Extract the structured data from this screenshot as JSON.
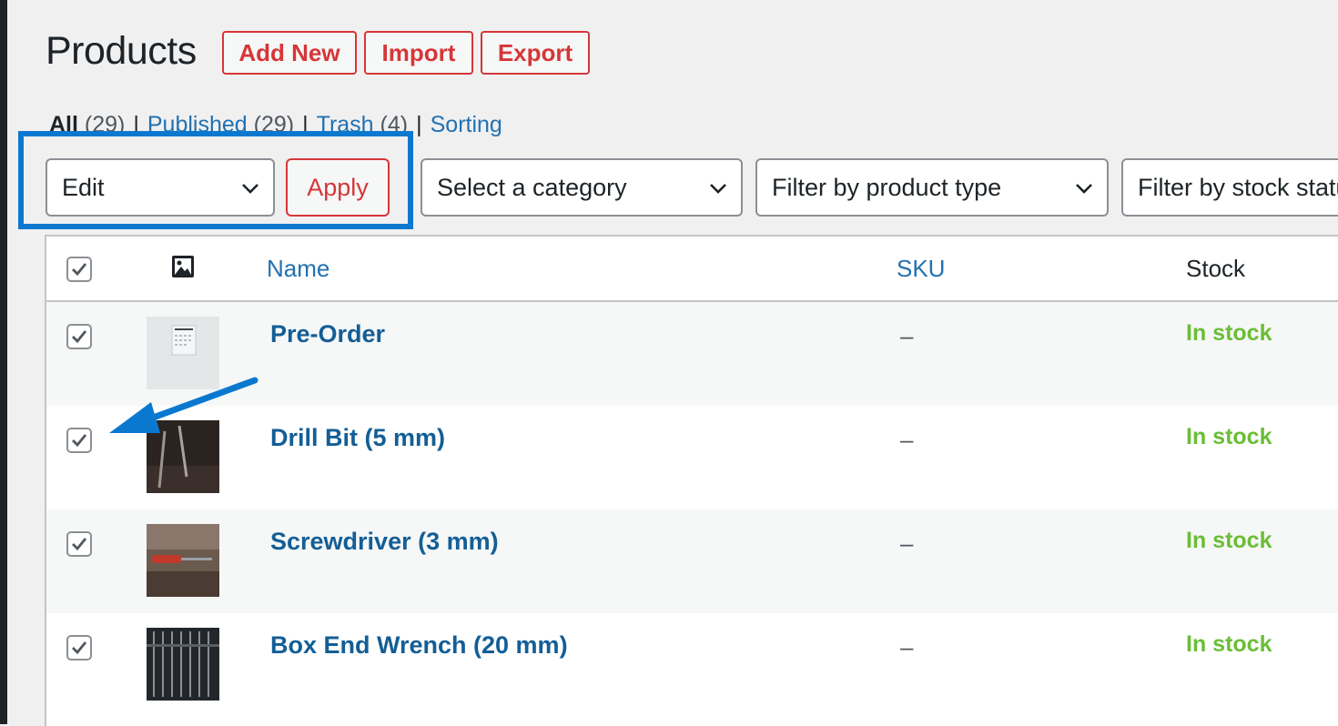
{
  "page": {
    "title": "Products",
    "buttons": {
      "add_new": "Add New",
      "import": "Import",
      "export": "Export"
    }
  },
  "views": {
    "all": {
      "label": "All",
      "count": "(29)"
    },
    "published": {
      "label": "Published",
      "count": "(29)"
    },
    "trash": {
      "label": "Trash",
      "count": "(4)"
    },
    "sorting": {
      "label": "Sorting"
    },
    "separator": "|"
  },
  "bulk_actions": {
    "selected": "Edit",
    "apply_label": "Apply"
  },
  "filters": {
    "category": "Select a category",
    "product_type": "Filter by product type",
    "stock_status": "Filter by stock status"
  },
  "table": {
    "columns": {
      "name": "Name",
      "sku": "SKU",
      "stock": "Stock"
    },
    "rows": [
      {
        "name": "Pre-Order",
        "sku": "–",
        "stock": "In stock",
        "checked": true
      },
      {
        "name": "Drill Bit (5 mm)",
        "sku": "–",
        "stock": "In stock",
        "checked": true
      },
      {
        "name": "Screwdriver (3 mm)",
        "sku": "–",
        "stock": "In stock",
        "checked": true
      },
      {
        "name": "Box End Wrench (20 mm)",
        "sku": "–",
        "stock": "In stock",
        "checked": true
      }
    ]
  },
  "colors": {
    "accent_red": "#d63638",
    "link_blue": "#2271b1",
    "product_link": "#135e96",
    "in_stock_green": "#6abe36",
    "highlight_blue": "#0b78d0"
  },
  "icons": {
    "image_column": "image-icon",
    "dropdown": "chevron-down-icon",
    "checkbox": "checkmark-icon",
    "annotation": "arrow-icon"
  }
}
